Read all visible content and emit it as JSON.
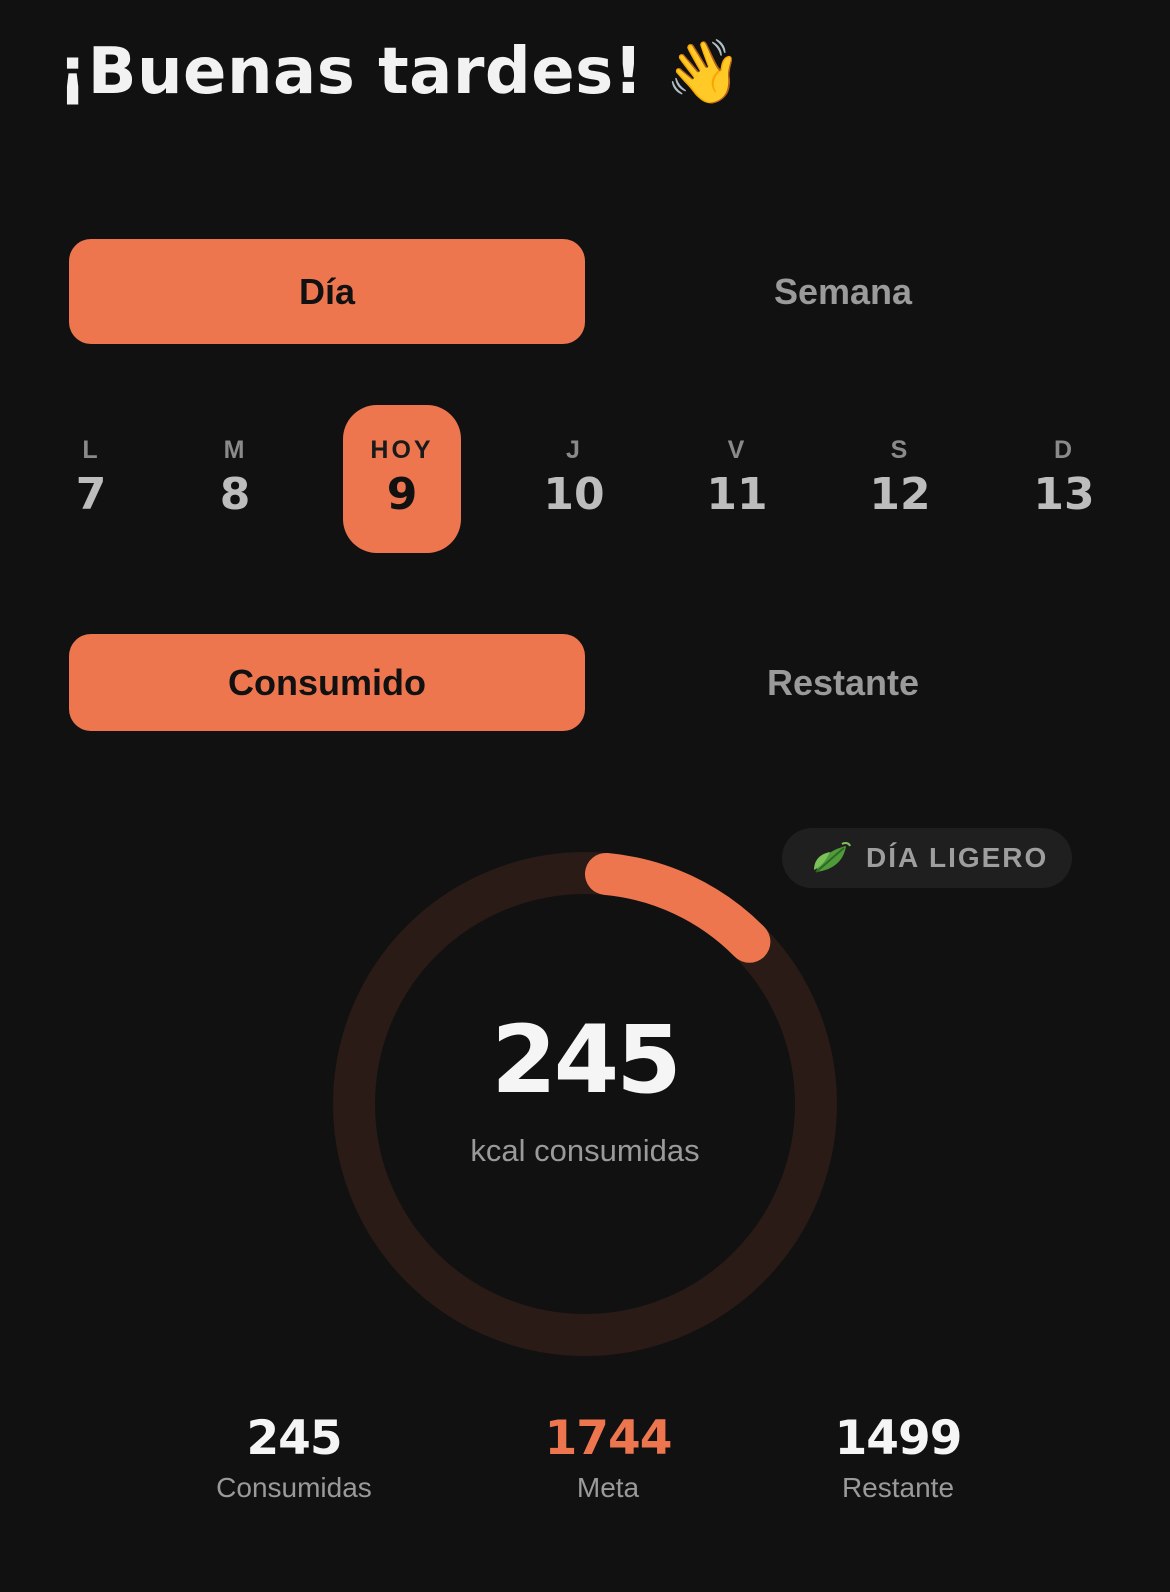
{
  "header": {
    "greeting": "¡Buenas tardes!",
    "wave_emoji": "👋"
  },
  "range_tabs": {
    "items": [
      {
        "label": "Día",
        "active": true
      },
      {
        "label": "Semana",
        "active": false
      }
    ]
  },
  "week": {
    "days": [
      {
        "letter": "L",
        "number": "7"
      },
      {
        "letter": "M",
        "number": "8"
      },
      {
        "letter": "HOY",
        "number": "9",
        "today": true
      },
      {
        "letter": "J",
        "number": "10"
      },
      {
        "letter": "V",
        "number": "11"
      },
      {
        "letter": "S",
        "number": "12"
      },
      {
        "letter": "D",
        "number": "13"
      }
    ]
  },
  "mode_tabs": {
    "items": [
      {
        "label": "Consumido",
        "active": true
      },
      {
        "label": "Restante",
        "active": false
      }
    ]
  },
  "badge": {
    "icon": "leaf-icon",
    "label": "DÍA LIGERO"
  },
  "ring": {
    "value": "245",
    "label": "kcal consumidas",
    "progress": 0.1405
  },
  "stats": [
    {
      "value": "245",
      "label": "Consumidas"
    },
    {
      "value": "1744",
      "label": "Meta",
      "accent": true
    },
    {
      "value": "1499",
      "label": "Restante"
    }
  ],
  "colors": {
    "background": "#111111",
    "accent": "#ed764f",
    "ring_track": "#2a1b16",
    "muted_text": "#9a9a9a"
  }
}
